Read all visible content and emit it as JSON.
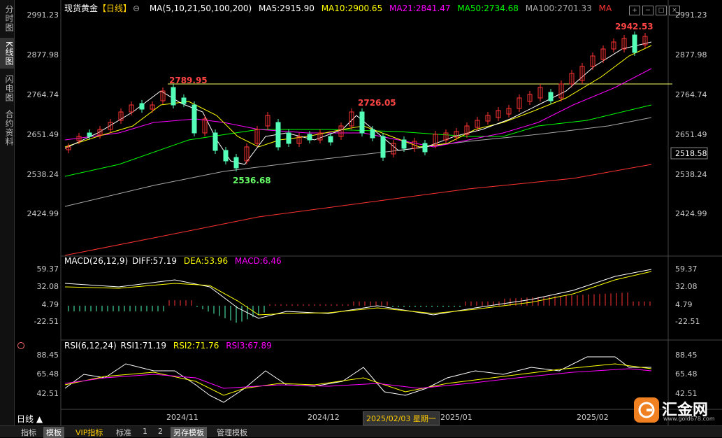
{
  "sidebar": {
    "tabs": [
      {
        "label": "分时图",
        "active": false
      },
      {
        "label": "K线图",
        "active": true
      },
      {
        "label": "闪电图",
        "active": false
      },
      {
        "label": "合约资料",
        "active": false
      }
    ]
  },
  "main_chart": {
    "title": "现货黄金",
    "period_tag": "【日线】",
    "ma_params": "MA(5,10,21,50,100,200)",
    "ma5": "MA5:2915.90",
    "ma10": "MA10:2900.65",
    "ma21": "MA21:2841.47",
    "ma50": "MA50:2734.68",
    "ma100": "MA100:2701.33",
    "ma200": "MA",
    "y_ticks": [
      "2991.23",
      "2877.98",
      "2764.74",
      "2651.49",
      "2538.24",
      "2424.99"
    ],
    "right_ticks": [
      "2991.23",
      "2877.98",
      "2764.74",
      "2651.49",
      "2538.24",
      "2424.99"
    ],
    "cursor_price": "2518.58",
    "annotations": {
      "high1": "2789.95",
      "high2": "2726.05",
      "low1": "2536.68",
      "high3": "2942.53"
    },
    "colors": {
      "up": "#ff3232",
      "down": "#54ffb8",
      "ma5": "#ffffff",
      "ma10": "#ffff00",
      "ma21": "#ff00ff",
      "ma50": "#00ff00",
      "ma100": "#aaaaaa",
      "ma200": "#ff3232"
    }
  },
  "macd": {
    "label": "MACD(26,12,9)",
    "diff": "DIFF:57.19",
    "dea": "DEA:53.96",
    "macd": "MACD:6.46",
    "ticks": [
      "59.37",
      "32.08",
      "4.79",
      "-22.51"
    ]
  },
  "rsi": {
    "label": "RSI(6,12,24)",
    "rsi1": "RSI1:71.19",
    "rsi2": "RSI2:71.76",
    "rsi3": "RSI3:67.89",
    "ticks": [
      "88.45",
      "65.48",
      "42.51"
    ]
  },
  "x_axis": {
    "period_label": "日线 ▲",
    "labels": [
      "2024/11",
      "2024/12",
      "2025/01",
      "2025/02"
    ],
    "cursor_date": "2025/02/03 星期一"
  },
  "bottom_bar": {
    "items": [
      "指标",
      "模板",
      "VIP指标",
      "标准",
      "1",
      "2",
      "另存模板",
      "管理模板"
    ],
    "active": [
      "模板",
      "另存模板"
    ]
  },
  "logo": {
    "text": "汇金网",
    "url": "www.gold678.com"
  }
}
